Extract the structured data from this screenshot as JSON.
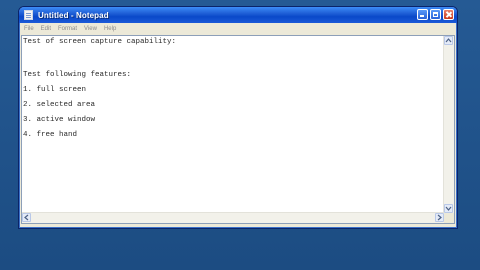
{
  "window": {
    "title": "Untitled - Notepad",
    "icon": "notepad-icon"
  },
  "menu": [
    "File",
    "Edit",
    "Format",
    "View",
    "Help"
  ],
  "document": {
    "lines": [
      "Test of screen capture capability:",
      "",
      "Test following features:",
      "1. full screen",
      "2. selected area",
      "3. active window",
      "4. free hand"
    ]
  },
  "colors": {
    "desktop": "#1f4f85",
    "titlebar": "#0a49c9"
  }
}
